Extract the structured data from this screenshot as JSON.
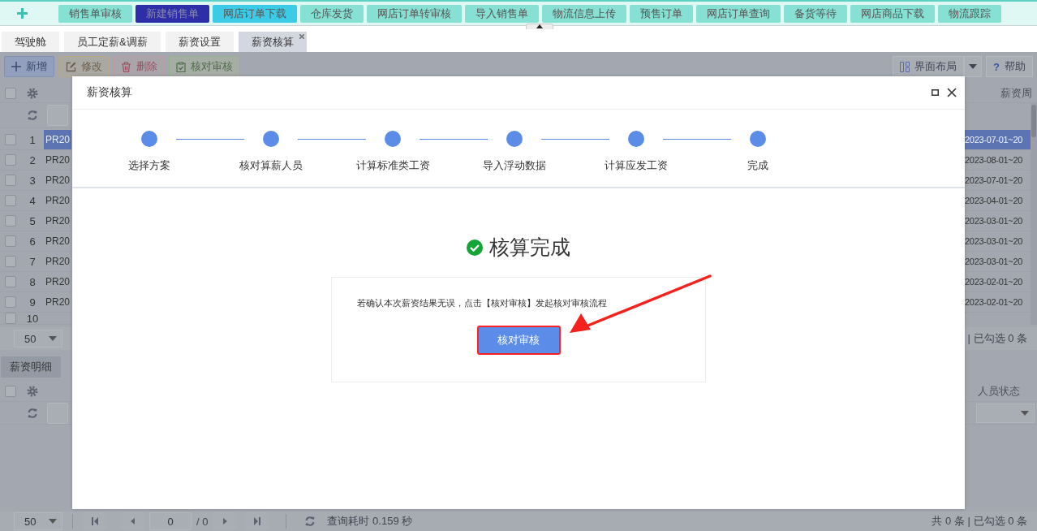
{
  "top_nav": {
    "items": [
      {
        "label": "销售单审核",
        "color": "#86e0d3"
      },
      {
        "label": "新建销售单",
        "color": "#2e2ea8"
      },
      {
        "label": "网店订单下载",
        "color": "#3ccbe7"
      },
      {
        "label": "仓库发货",
        "color": "#86e0d3"
      },
      {
        "label": "网店订单转审核",
        "color": "#86e0d3"
      },
      {
        "label": "导入销售单",
        "color": "#86e0d3"
      },
      {
        "label": "物流信息上传",
        "color": "#86e0d3"
      },
      {
        "label": "预售订单",
        "color": "#86e0d3"
      },
      {
        "label": "网店订单查询",
        "color": "#86e0d3"
      },
      {
        "label": "备货等待",
        "color": "#86e0d3"
      },
      {
        "label": "网店商品下载",
        "color": "#86e0d3"
      },
      {
        "label": "物流跟踪",
        "color": "#86e0d3"
      }
    ]
  },
  "tabs": [
    {
      "label": "驾驶舱",
      "selected": false
    },
    {
      "label": "员工定薪&调薪",
      "selected": false
    },
    {
      "label": "薪资设置",
      "selected": false
    },
    {
      "label": "薪资核算",
      "selected": true
    }
  ],
  "toolbar": {
    "buttons": [
      {
        "kind": "add",
        "label": "新增"
      },
      {
        "kind": "edit",
        "label": "修改"
      },
      {
        "kind": "delete",
        "label": "删除"
      },
      {
        "kind": "audit",
        "label": "核对审核"
      }
    ],
    "layout_button": "界面布局",
    "help_button": {
      "icon": "?",
      "label": "帮助"
    }
  },
  "upper_grid": {
    "column_right": "薪资周",
    "rows": [
      {
        "number": "1",
        "code": "PR20",
        "period": "2023-07-01~20",
        "selected": true,
        "checked": false
      },
      {
        "number": "2",
        "code": "PR20",
        "period": "2023-08-01~20",
        "selected": false,
        "checked": false
      },
      {
        "number": "3",
        "code": "PR20",
        "period": "2023-07-01~20",
        "selected": false,
        "checked": false
      },
      {
        "number": "4",
        "code": "PR20",
        "period": "2023-04-01~20",
        "selected": false,
        "checked": false
      },
      {
        "number": "5",
        "code": "PR20",
        "period": "2023-03-01~20",
        "selected": false,
        "checked": false
      },
      {
        "number": "6",
        "code": "PR20",
        "period": "2023-03-01~20",
        "selected": false,
        "checked": false
      },
      {
        "number": "7",
        "code": "PR20",
        "period": "2023-03-01~20",
        "selected": false,
        "checked": false
      },
      {
        "number": "8",
        "code": "PR20",
        "period": "2023-02-01~20",
        "selected": false,
        "checked": false
      },
      {
        "number": "9",
        "code": "PR20",
        "period": "2023-02-01~20",
        "selected": false,
        "checked": false
      },
      {
        "number": "10",
        "checked": false
      }
    ],
    "all_checked": false,
    "page_size": "50",
    "selection_summary": "| 已勾选 0 条"
  },
  "lower_panel": {
    "tab": "薪资明细",
    "all_checked": false,
    "column_right": "人员状态",
    "pager": {
      "page_size": "50",
      "page": "0",
      "total_pages": "/ 0",
      "query_time": "查询耗时 0.159 秒",
      "summary": "共 0 条 | 已勾选 0 条"
    }
  },
  "dialog": {
    "title": "薪资核算",
    "steps": [
      {
        "label": "选择方案"
      },
      {
        "label": "核对算薪人员"
      },
      {
        "label": "计算标准类工资"
      },
      {
        "label": "导入浮动数据"
      },
      {
        "label": "计算应发工资"
      },
      {
        "label": "完成"
      }
    ],
    "result_title": "核算完成",
    "message": "若确认本次薪资结果无误，点击【核对审核】发起核对审核流程",
    "action_button": "核对审核"
  }
}
